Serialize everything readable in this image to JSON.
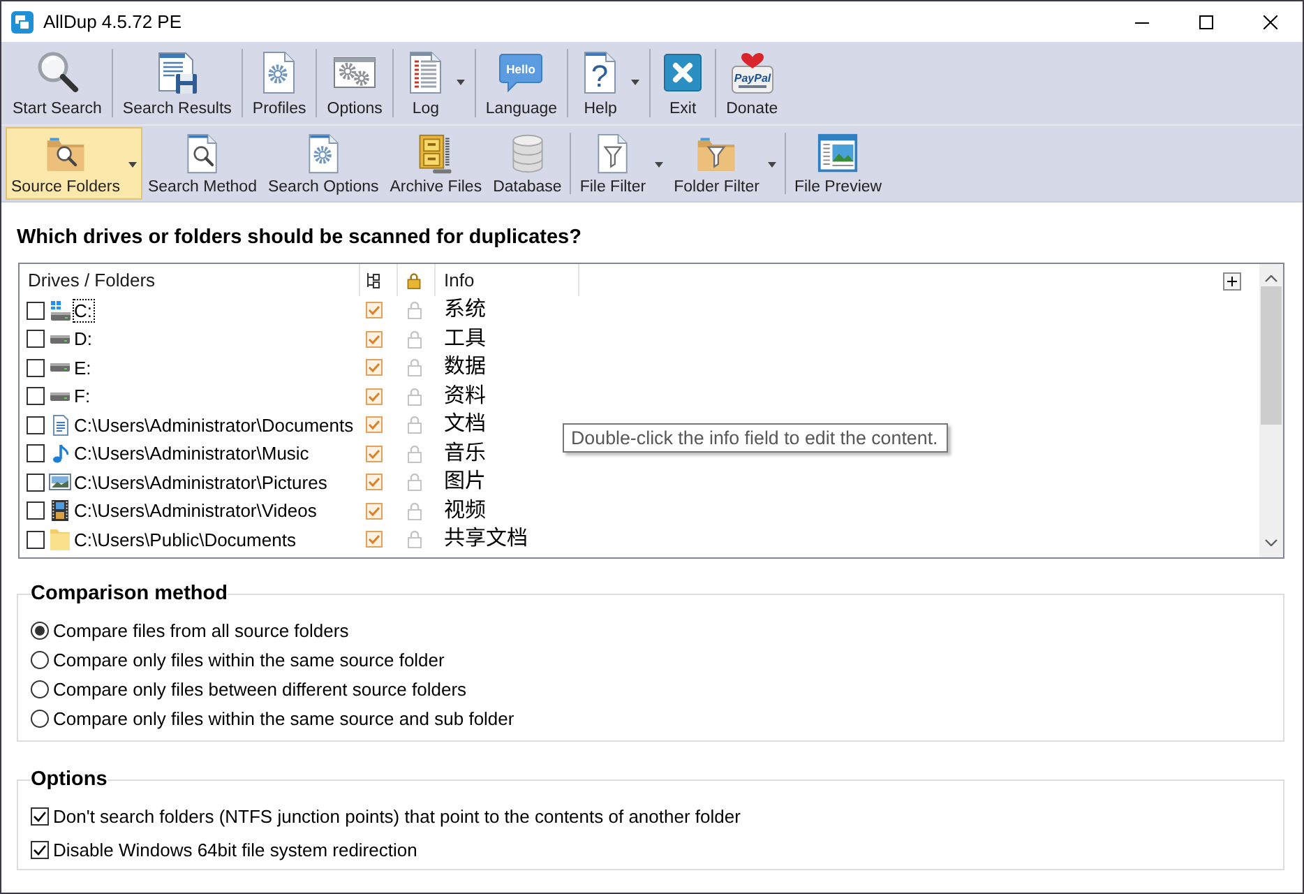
{
  "window": {
    "title": "AllDup 4.5.72 PE"
  },
  "main_toolbar": {
    "buttons": [
      {
        "label": "Start Search",
        "has_menu": false
      },
      {
        "label": "Search Results",
        "has_menu": false
      },
      {
        "label": "Profiles",
        "has_menu": false
      },
      {
        "label": "Options",
        "has_menu": false
      },
      {
        "label": "Log",
        "has_menu": true
      },
      {
        "label": "Language",
        "has_menu": false,
        "icon_text": "Hello"
      },
      {
        "label": "Help",
        "has_menu": true,
        "icon_text": "?"
      },
      {
        "label": "Exit",
        "has_menu": false
      },
      {
        "label": "Donate",
        "has_menu": false,
        "icon_text": "PayPal"
      }
    ]
  },
  "section_toolbar": {
    "groups": [
      {
        "buttons": [
          {
            "label": "Source Folders",
            "selected": true,
            "has_menu": true
          },
          {
            "label": "Search Method",
            "selected": false,
            "has_menu": false
          },
          {
            "label": "Search Options",
            "selected": false,
            "has_menu": false
          },
          {
            "label": "Archive Files",
            "selected": false,
            "has_menu": false
          },
          {
            "label": "Database",
            "selected": false,
            "has_menu": false
          }
        ]
      },
      {
        "buttons": [
          {
            "label": "File Filter",
            "selected": false,
            "has_menu": true
          },
          {
            "label": "Folder Filter",
            "selected": false,
            "has_menu": true
          }
        ]
      },
      {
        "buttons": [
          {
            "label": "File Preview",
            "selected": false,
            "has_menu": false
          }
        ]
      }
    ]
  },
  "source_prompt": "Which drives or folders should be scanned for duplicates?",
  "source_list": {
    "columns": {
      "path": "Drives / Folders",
      "info": "Info"
    },
    "rows": [
      {
        "kind": "system-drive",
        "path": "C:",
        "checked": false,
        "focused": true,
        "subfolders": true,
        "protected": false,
        "info": "系统"
      },
      {
        "kind": "drive",
        "path": "D:",
        "checked": false,
        "focused": false,
        "subfolders": true,
        "protected": false,
        "info": "工具"
      },
      {
        "kind": "drive",
        "path": "E:",
        "checked": false,
        "focused": false,
        "subfolders": true,
        "protected": false,
        "info": "数据"
      },
      {
        "kind": "drive",
        "path": "F:",
        "checked": false,
        "focused": false,
        "subfolders": true,
        "protected": false,
        "info": "资料"
      },
      {
        "kind": "documents",
        "path": "C:\\Users\\Administrator\\Documents",
        "checked": false,
        "focused": false,
        "subfolders": true,
        "protected": false,
        "info": "文档"
      },
      {
        "kind": "music",
        "path": "C:\\Users\\Administrator\\Music",
        "checked": false,
        "focused": false,
        "subfolders": true,
        "protected": false,
        "info": "音乐"
      },
      {
        "kind": "pictures",
        "path": "C:\\Users\\Administrator\\Pictures",
        "checked": false,
        "focused": false,
        "subfolders": true,
        "protected": false,
        "info": "图片"
      },
      {
        "kind": "videos",
        "path": "C:\\Users\\Administrator\\Videos",
        "checked": false,
        "focused": false,
        "subfolders": true,
        "protected": false,
        "info": "视频"
      },
      {
        "kind": "folder",
        "path": "C:\\Users\\Public\\Documents",
        "checked": false,
        "focused": false,
        "subfolders": true,
        "protected": false,
        "info": "共享文档"
      }
    ]
  },
  "tooltip": {
    "text": "Double-click the info field to edit the content."
  },
  "comparison": {
    "title": "Comparison method",
    "options": [
      {
        "label": "Compare files from all source folders",
        "selected": true
      },
      {
        "label": "Compare only files within the same source folder",
        "selected": false
      },
      {
        "label": "Compare only files between different source folders",
        "selected": false
      },
      {
        "label": "Compare only files within the same source and sub folder",
        "selected": false
      }
    ]
  },
  "options": {
    "title": "Options",
    "items": [
      {
        "label": "Don't search folders (NTFS junction points) that point to the contents of another folder",
        "checked": true
      },
      {
        "label": "Disable Windows 64bit file system redirection",
        "checked": true
      }
    ]
  }
}
